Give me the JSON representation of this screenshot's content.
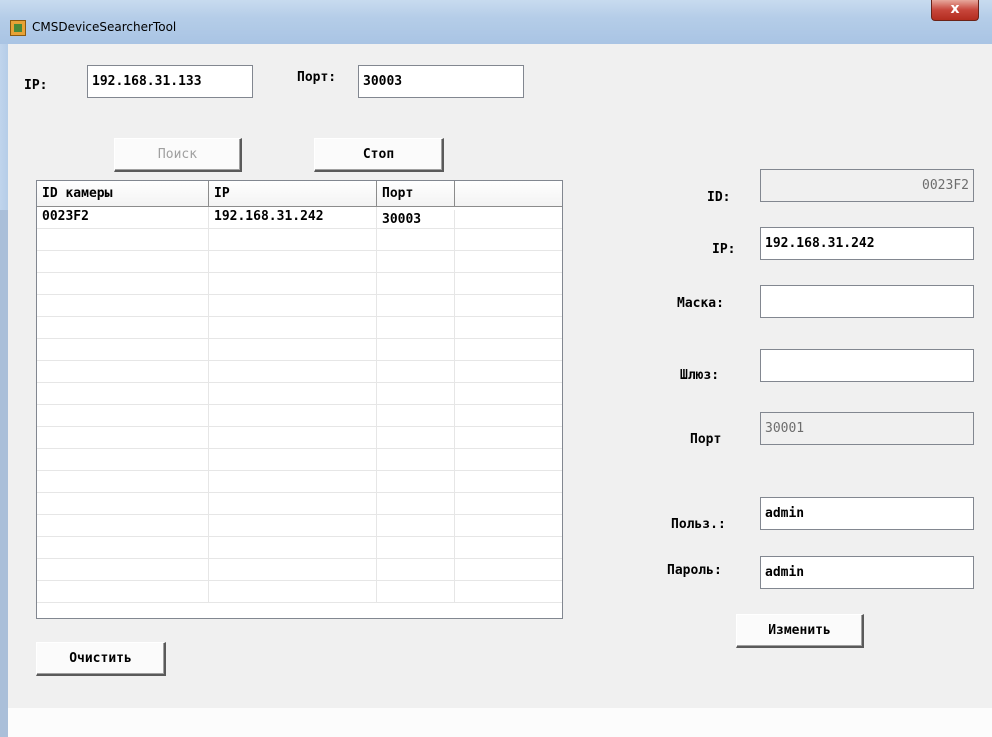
{
  "window": {
    "title": "CMSDeviceSearcherTool",
    "close_label": "x"
  },
  "search": {
    "ip_label": "IP:",
    "ip_value": "192.168.31.133",
    "port_label": "Порт:",
    "port_value": "30003",
    "search_button": "Поиск",
    "stop_button": "Стоп"
  },
  "table": {
    "columns": [
      "ID камеры",
      "IP",
      "Порт",
      ""
    ],
    "rows": [
      [
        "0023F2",
        "192.168.31.242",
        "30003",
        ""
      ]
    ]
  },
  "clear_button": "Очистить",
  "details": {
    "id_label": "ID:",
    "id_value": "0023F2",
    "ip_label": "IP:",
    "ip_value": "192.168.31.242",
    "mask_label": "Маска:",
    "mask_value": "",
    "gateway_label": "Шлюз:",
    "gateway_value": "",
    "port_label": "Порт",
    "port_value": "30001",
    "user_label": "Польз.:",
    "user_value": "admin",
    "password_label": "Пароль:",
    "password_value": "admin",
    "change_button": "Изменить"
  }
}
